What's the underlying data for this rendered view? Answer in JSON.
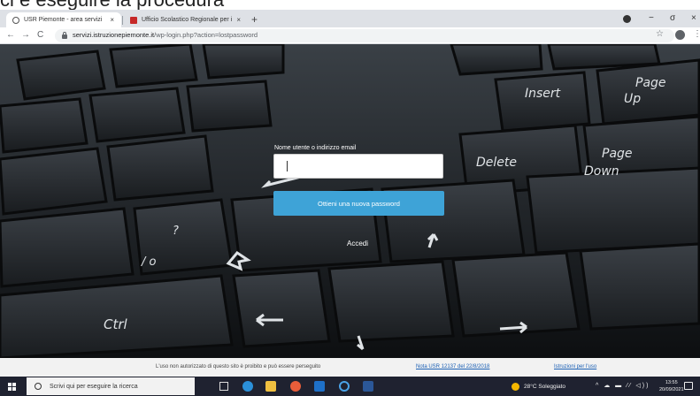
{
  "caption": {
    "text": "ci e eseguire la procedura"
  },
  "browser": {
    "tabs": [
      {
        "title": "USR Piemonte - area servizi",
        "close": "×",
        "active": true
      },
      {
        "title": "Ufficio Scolastico Regionale per i",
        "close": "×",
        "active": false
      }
    ],
    "new_tab": "+",
    "window_controls": {
      "minimize": "−",
      "maximize": "σ",
      "close": "×"
    },
    "nav": {
      "back": "←",
      "forward": "→",
      "reload": "C"
    },
    "url_host": "servizi.istruzionepiemonte.it",
    "url_path": "/wp-login.php?action=lostpassword",
    "star": "☆",
    "kebab": "⋮"
  },
  "page": {
    "form": {
      "label": "Nome utente o indirizzo email",
      "value": "",
      "submit": "Ottieni una nuova password",
      "login_link": "Accedi"
    },
    "keys": {
      "insert": "Insert",
      "page_up_1": "Page",
      "page_up_2": "Up",
      "delete": "Delete",
      "page_down_1": "Page",
      "page_down_2": "Down",
      "ctrl": "Ctrl",
      "slash": "/ o",
      "question": "?"
    },
    "footer": {
      "disclaimer": "L'uso non autorizzato di questo sito è proibito e può essere perseguito",
      "nota": "Nota USR 12137 del 22/8/2018",
      "istruzioni": "Istruzioni per l'uso"
    }
  },
  "taskbar": {
    "search_placeholder": "Scrivi qui per eseguire la ricerca",
    "weather": "28°C Soleggiato",
    "tray": "^ ☁ ▬ ⁄⁄ ◁))",
    "time": "13:55",
    "date": "20/09/2021"
  },
  "colors": {
    "button": "#3ea3d7",
    "taskbar": "#1f2230",
    "footer_link": "#1a5fb4"
  }
}
